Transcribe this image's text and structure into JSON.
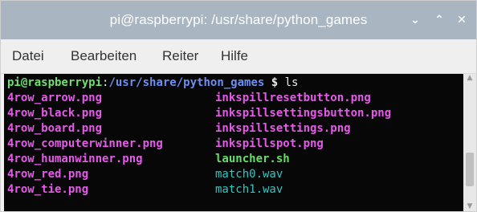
{
  "window": {
    "title": "pi@raspberrypi: /usr/share/python_games",
    "minimize_glyph": "⌄",
    "maximize_glyph": "⌃",
    "close_glyph": "✕"
  },
  "menu": {
    "items": [
      "Datei",
      "Bearbeiten",
      "Reiter",
      "Hilfe"
    ]
  },
  "terminal": {
    "prompt_user": "pi@raspberrypi",
    "prompt_sep": ":",
    "prompt_path": "/usr/share/python_games",
    "prompt_symbol": " $ ",
    "command": "ls",
    "files_col1": [
      "4row_arrow.png",
      "4row_black.png",
      "4row_board.png",
      "4row_computerwinner.png",
      "4row_humanwinner.png",
      "4row_red.png",
      "4row_tie.png"
    ],
    "files_col2": [
      "inkspillresetbutton.png",
      "inkspillsettingsbutton.png",
      "inkspillsettings.png",
      "inkspillspot.png",
      "launcher.sh",
      "match0.wav",
      "match1.wav"
    ]
  },
  "colors": {
    "titlebar": "#a9b6c2",
    "terminal_bg": "#070707",
    "prompt_user": "#6ee06e",
    "prompt_path": "#6d8ef2",
    "image_file": "#e659ea",
    "executable_file": "#63e063",
    "audio_file": "#2fc7c4"
  },
  "icons": {
    "minimize": "chevron-down-icon",
    "maximize": "chevron-up-icon",
    "close": "close-icon"
  }
}
